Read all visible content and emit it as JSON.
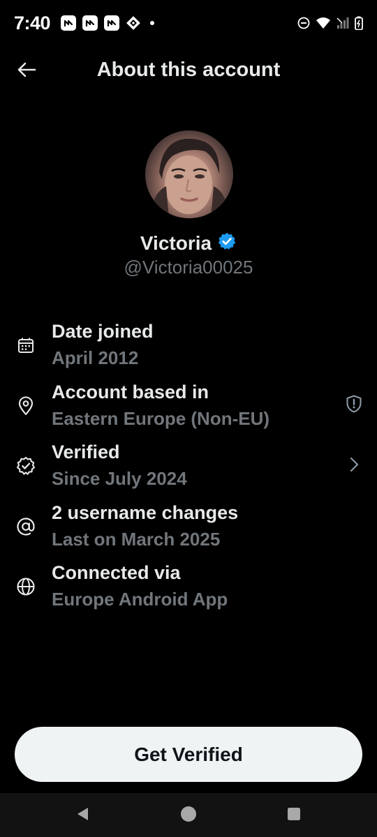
{
  "status_bar": {
    "time": "7:40",
    "notification_icons": [
      "n-app-icon",
      "n-app-icon",
      "n-app-icon",
      "diamond-app-icon"
    ],
    "system_icons": [
      "do-not-disturb-icon",
      "wifi-icon",
      "signal-icon",
      "battery-icon"
    ]
  },
  "header": {
    "title": "About this account",
    "back_icon": "arrow-left-icon"
  },
  "profile": {
    "display_name": "Victoria",
    "handle": "@Victoria00025",
    "verified_badge_color": "#1d9bf0"
  },
  "info_items": [
    {
      "icon": "calendar-icon",
      "title": "Date joined",
      "subtitle": "April 2012",
      "action": ""
    },
    {
      "icon": "location-pin-icon",
      "title": "Account based in",
      "subtitle": "Eastern Europe (Non-EU)",
      "action": "shield-alert-icon"
    },
    {
      "icon": "verified-badge-outline-icon",
      "title": "Verified",
      "subtitle": "Since July 2024",
      "action": "chevron-right-icon"
    },
    {
      "icon": "at-sign-icon",
      "title": "2 username changes",
      "subtitle": "Last on March 2025",
      "action": ""
    },
    {
      "icon": "globe-icon",
      "title": "Connected via",
      "subtitle": "Europe Android App",
      "action": ""
    }
  ],
  "cta": {
    "label": "Get Verified"
  },
  "nav_bar": {
    "buttons": [
      "back-triangle-icon",
      "home-circle-icon",
      "recents-square-icon"
    ]
  },
  "colors": {
    "background": "#000000",
    "primary_text": "#e7e9ea",
    "secondary_text": "#71767b",
    "accent": "#1d9bf0",
    "button_bg": "#eff3f4",
    "button_text": "#0f1419"
  }
}
